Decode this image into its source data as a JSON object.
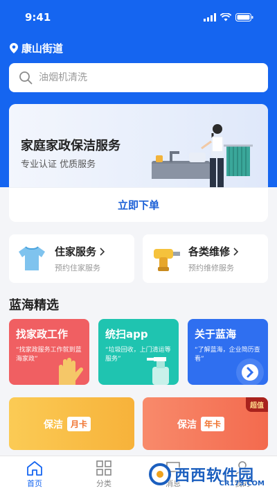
{
  "status_bar": {
    "time": "9:41"
  },
  "location": {
    "name": "康山街道"
  },
  "search": {
    "placeholder": "油烟机清洗"
  },
  "banner": {
    "title": "家庭家政保洁服务",
    "subtitle": "专业认证 优质服务",
    "cta": "立即下单"
  },
  "services": [
    {
      "title": "住家服务",
      "subtitle": "预约住家服务"
    },
    {
      "title": "各类维修",
      "subtitle": "预约维修服务"
    }
  ],
  "section": {
    "title": "蓝海精选"
  },
  "picks": [
    {
      "title": "找家政工作",
      "desc": "“找家政服务工作就到蓝海家政”",
      "color": "#f05f62"
    },
    {
      "title": "统扫app",
      "desc": "“垃圾回收，上门清运等服务”",
      "color": "#1fc4b0"
    },
    {
      "title": "关于蓝海",
      "desc": "“了解蓝海，企业简历查看”",
      "color": "#2f6ff0"
    }
  ],
  "promos": [
    {
      "label": "保洁",
      "tag": "月卡",
      "color": "#f9bf46"
    },
    {
      "label": "保洁",
      "tag": "年卡",
      "badge": "超值",
      "color": "#f57d5f"
    }
  ],
  "tabbar": {
    "items": [
      {
        "label": "首页",
        "active": true
      },
      {
        "label": "分类",
        "active": false
      },
      {
        "label": "消息",
        "active": false
      },
      {
        "label": "我的",
        "active": false
      }
    ]
  },
  "watermark": {
    "text": "西西软件园",
    "sub": "CR173.COM"
  },
  "colors": {
    "primary": "#1565f0",
    "cta": "#1a5fd6"
  }
}
